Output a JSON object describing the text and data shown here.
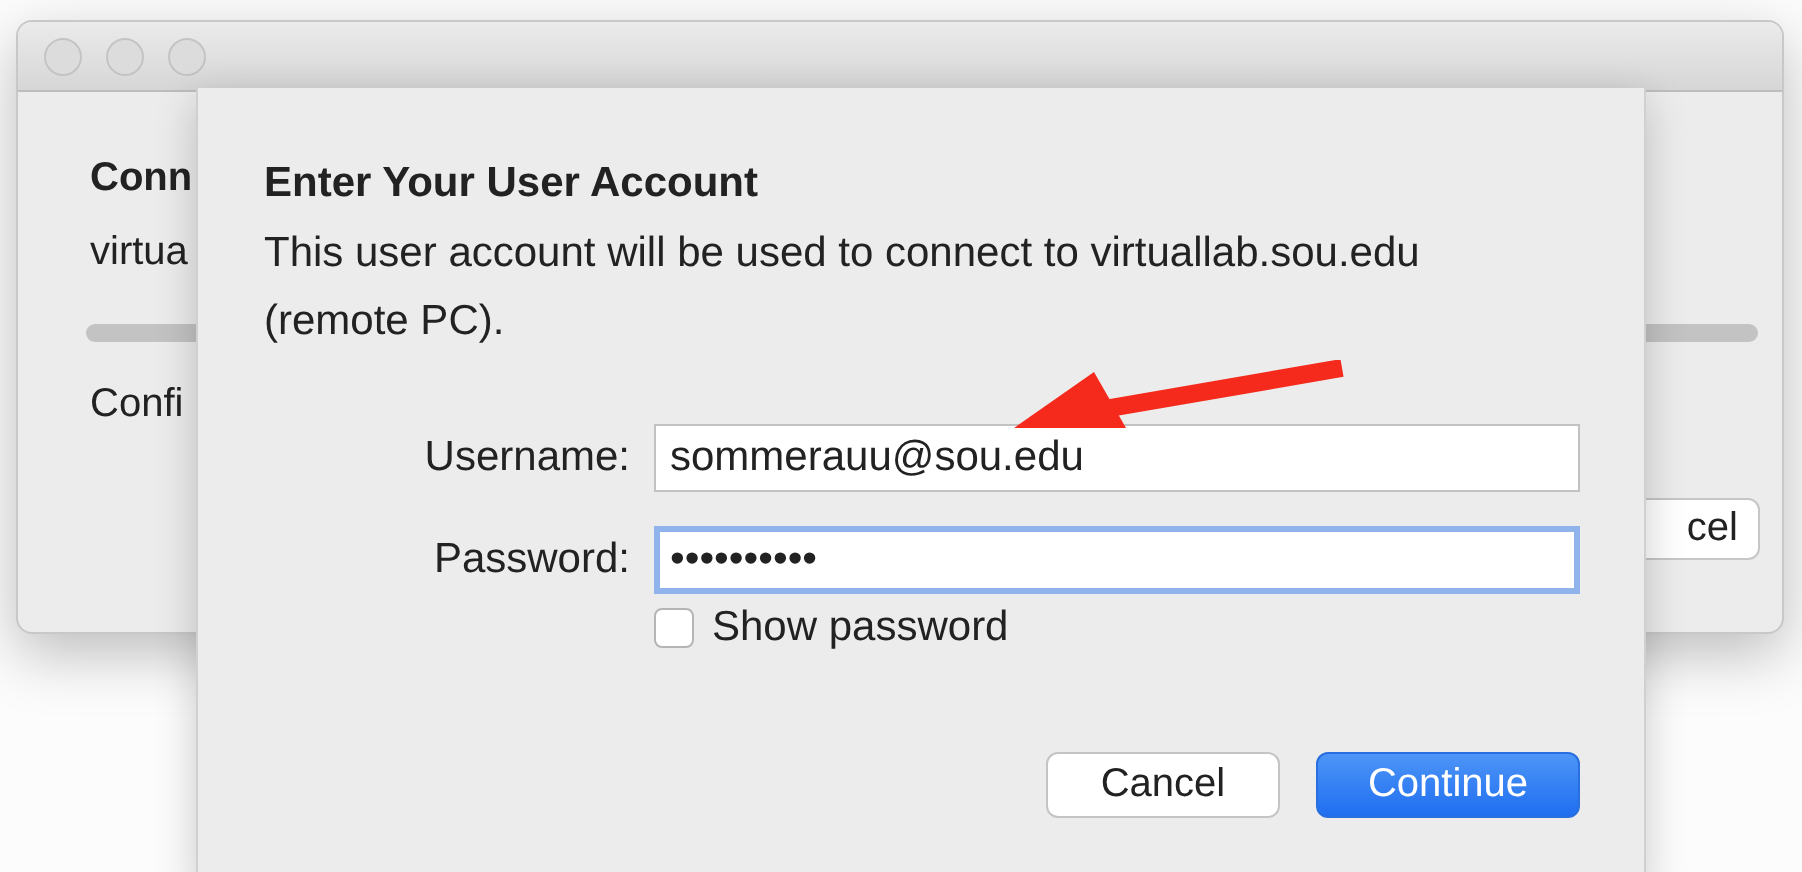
{
  "background_window": {
    "heading": "Conn",
    "line": "virtua",
    "status": "Confi",
    "button": "cel"
  },
  "sheet": {
    "title": "Enter Your User Account",
    "description": "This user account will be used to connect to virtuallab.sou.edu (remote PC).",
    "fields": [
      {
        "label": "Username:",
        "value": "sommerauu@sou.edu",
        "focused": false
      },
      {
        "label": "Password:",
        "value": "••••••••••",
        "focused": true
      }
    ],
    "show_password": {
      "label": "Show password",
      "checked": false
    },
    "buttons": [
      {
        "label": "Cancel",
        "default": false
      },
      {
        "label": "Continue",
        "default": true
      }
    ]
  }
}
